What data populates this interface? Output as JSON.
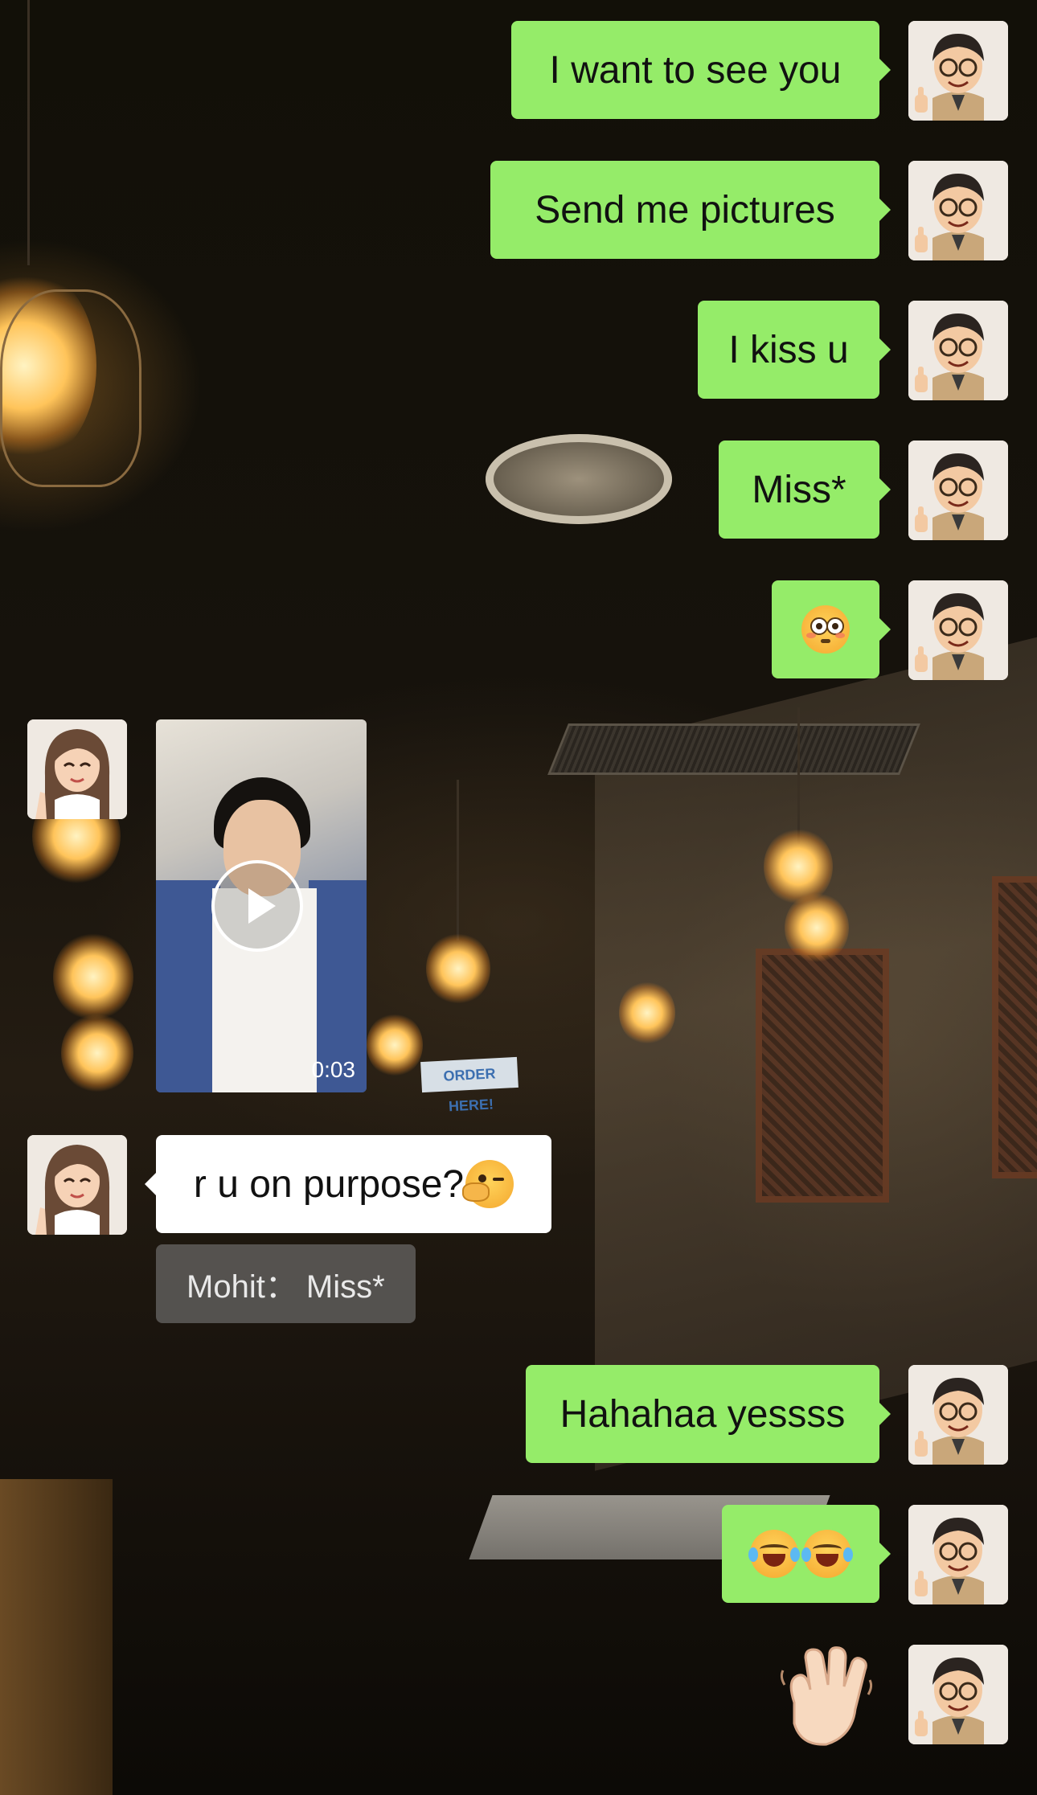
{
  "messages": [
    {
      "side": "me",
      "type": "text",
      "text": "I want to see you"
    },
    {
      "side": "me",
      "type": "text",
      "text": "Send me pictures"
    },
    {
      "side": "me",
      "type": "text",
      "text": "I kiss u"
    },
    {
      "side": "me",
      "type": "text",
      "text": "Miss*"
    },
    {
      "side": "me",
      "type": "emoji",
      "emoji": "flushed-face"
    },
    {
      "side": "them",
      "type": "video",
      "duration": "0:03"
    },
    {
      "side": "them",
      "type": "text",
      "text": "r u on purpose?",
      "emoji": "face-with-hand-over-mouth-wink"
    },
    {
      "type": "quote",
      "text": "Mohit： Miss*"
    },
    {
      "side": "me",
      "type": "text",
      "text": "Hahahaa yessss"
    },
    {
      "side": "me",
      "type": "emoji",
      "emoji": "rolling-on-floor-laughing x2"
    },
    {
      "side": "me",
      "type": "sticker",
      "emoji": "waving-hand"
    }
  ],
  "colors": {
    "my_bubble": "#95ec69",
    "their_bubble": "#ffffff",
    "quote_bg": "#787878",
    "backdrop": "#16120c"
  },
  "avatars": {
    "me": "cartoon-man-glasses-thumbs-up",
    "them": "cartoon-woman-peace-sign"
  }
}
